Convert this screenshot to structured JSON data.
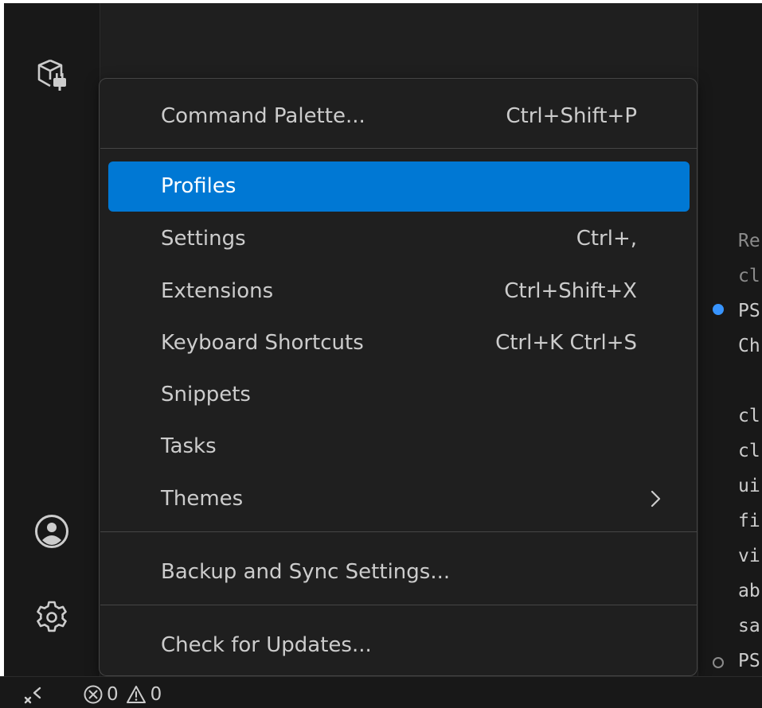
{
  "menu": {
    "items": [
      {
        "label": "Command Palette...",
        "shortcut": "Ctrl+Shift+P"
      },
      {
        "label": "Profiles",
        "shortcut": ""
      },
      {
        "label": "Settings",
        "shortcut": "Ctrl+,"
      },
      {
        "label": "Extensions",
        "shortcut": "Ctrl+Shift+X"
      },
      {
        "label": "Keyboard Shortcuts",
        "shortcut": "Ctrl+K Ctrl+S"
      },
      {
        "label": "Snippets",
        "shortcut": ""
      },
      {
        "label": "Tasks",
        "shortcut": ""
      },
      {
        "label": "Themes",
        "shortcut": ""
      },
      {
        "label": "Backup and Sync Settings...",
        "shortcut": ""
      },
      {
        "label": "Check for Updates...",
        "shortcut": ""
      }
    ],
    "selected_label": "Profiles"
  },
  "terminal": {
    "lines": [
      "Re",
      "cl",
      "PS",
      "Ch",
      "cl",
      "cl",
      "ui",
      "fi",
      "vi",
      "ab",
      "sa",
      "PS"
    ]
  },
  "status_bar": {
    "errors": "0",
    "warnings": "0"
  },
  "colors": {
    "accent": "#0078d4",
    "terminal_success_dot": "#3794ff"
  },
  "icons": {
    "activity_top": "remote-explorer-icon",
    "account": "account-icon",
    "manage": "gear-icon",
    "remote": "remote-indicator-icon",
    "error": "error-icon",
    "warning": "warning-icon",
    "submenu": "chevron-right-icon"
  }
}
